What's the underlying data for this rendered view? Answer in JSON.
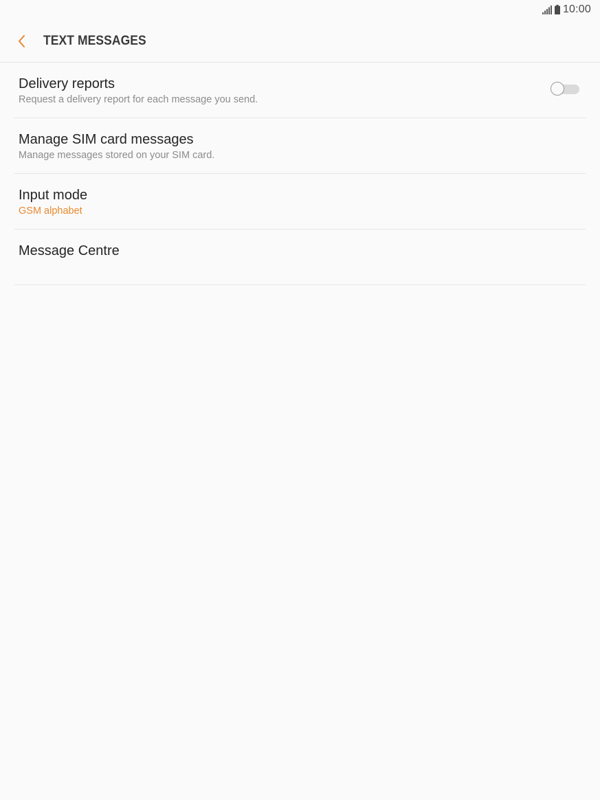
{
  "status_bar": {
    "time": "10:00",
    "signal_icon": "signal-icon",
    "battery_icon": "battery-icon"
  },
  "app_bar": {
    "back_icon": "chevron-left-icon",
    "title": "TEXT MESSAGES"
  },
  "settings": [
    {
      "title": "Delivery reports",
      "subtitle": "Request a delivery report for each message you send.",
      "toggle": false
    },
    {
      "title": "Manage SIM card messages",
      "subtitle": "Manage messages stored on your SIM card."
    },
    {
      "title": "Input mode",
      "subtitle": "GSM alphabet"
    },
    {
      "title": "Message Centre"
    }
  ],
  "colors": {
    "accent": "#e8892e",
    "background": "#fafafa",
    "divider": "#e6e6e6",
    "title_text": "#252525",
    "subtitle_text": "#8c8c8c"
  }
}
